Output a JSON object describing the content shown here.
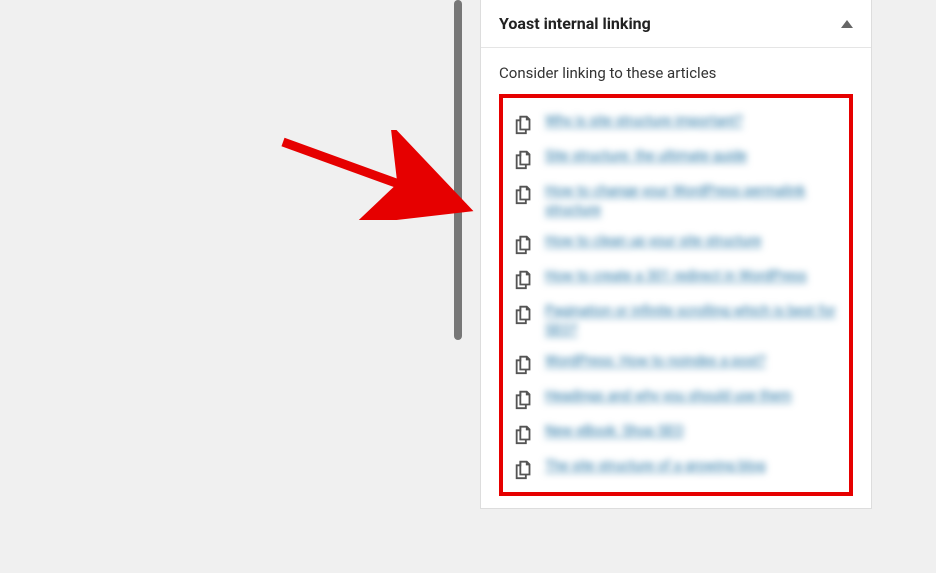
{
  "panel": {
    "title": "Yoast internal linking",
    "subheading": "Consider linking to these articles",
    "items": [
      "Why is site structure important?",
      "Site structure: the ultimate guide",
      "How to change your WordPress permalink structure",
      "How to clean up your site structure",
      "How to create a 301 redirect in WordPress",
      "Pagination or infinite scrolling which is best for SEO?",
      "WordPress: How to noindex a post?",
      "Headings and why you should use them",
      "New eBook: Shop SEO",
      "The site structure of a growing blog"
    ]
  },
  "colors": {
    "highlight_border": "#e60000",
    "link": "#1a6ea0",
    "arrow": "#e60000"
  }
}
